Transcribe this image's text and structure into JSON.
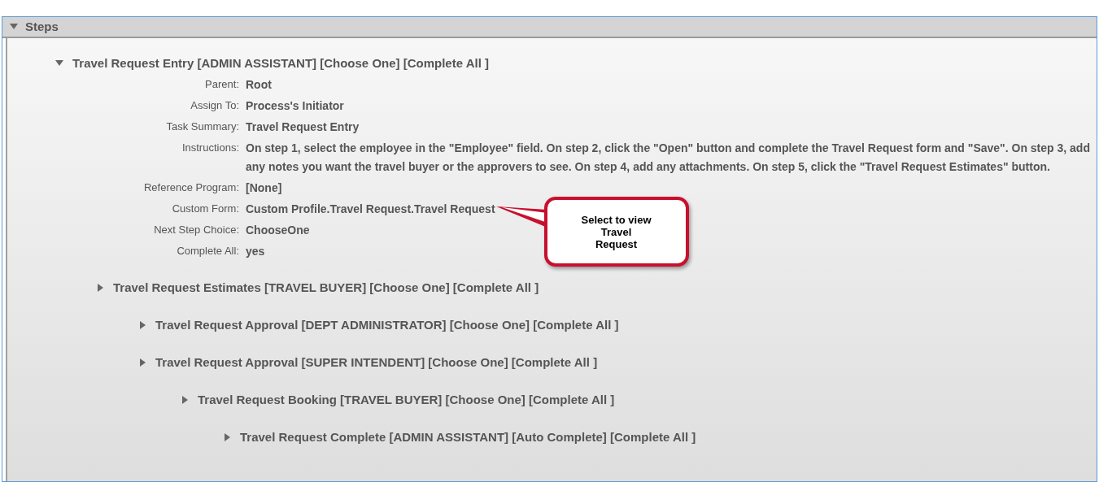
{
  "panel": {
    "title": "Steps",
    "expanded": true
  },
  "steps": [
    {
      "label": "Travel Request Entry [ADMIN ASSISTANT] [Choose One] [Complete All ]",
      "expanded": true,
      "details": [
        {
          "label": "Parent:",
          "value": "Root"
        },
        {
          "label": "Assign To:",
          "value": "Process's Initiator"
        },
        {
          "label": "Task Summary:",
          "value": "Travel Request Entry"
        },
        {
          "label": "Instructions:",
          "value": "On step 1, select the employee in the \"Employee\" field. On step 2, click the \"Open\" button and complete the Travel Request form and \"Save\". On step 3, add any notes you want the travel buyer or the approvers to see. On step 4, add any attachments. On step 5, click the \"Travel Request Estimates\" button."
        },
        {
          "label": "Reference Program:",
          "value": "[None]"
        },
        {
          "label": "Custom Form:",
          "value": "Custom Profile.Travel Request.Travel Request",
          "callout": "Select to view Travel Request"
        },
        {
          "label": "Next Step Choice:",
          "value": "ChooseOne"
        },
        {
          "label": "Complete All:",
          "value": "yes"
        }
      ],
      "children": [
        {
          "label": "Travel Request Estimates [TRAVEL BUYER] [Choose One] [Complete All ]",
          "expanded": false,
          "children": [
            {
              "label": "Travel Request Approval [DEPT ADMINISTRATOR] [Choose One] [Complete All ]",
              "expanded": false
            },
            {
              "label": "Travel Request Approval [SUPER INTENDENT] [Choose One] [Complete All ]",
              "expanded": false,
              "children": [
                {
                  "label": "Travel Request Booking [TRAVEL BUYER] [Choose One] [Complete All ]",
                  "expanded": false,
                  "children": [
                    {
                      "label": "Travel Request Complete [ADMIN ASSISTANT] [Auto Complete] [Complete All ]",
                      "expanded": false
                    }
                  ]
                }
              ]
            }
          ]
        }
      ]
    }
  ]
}
